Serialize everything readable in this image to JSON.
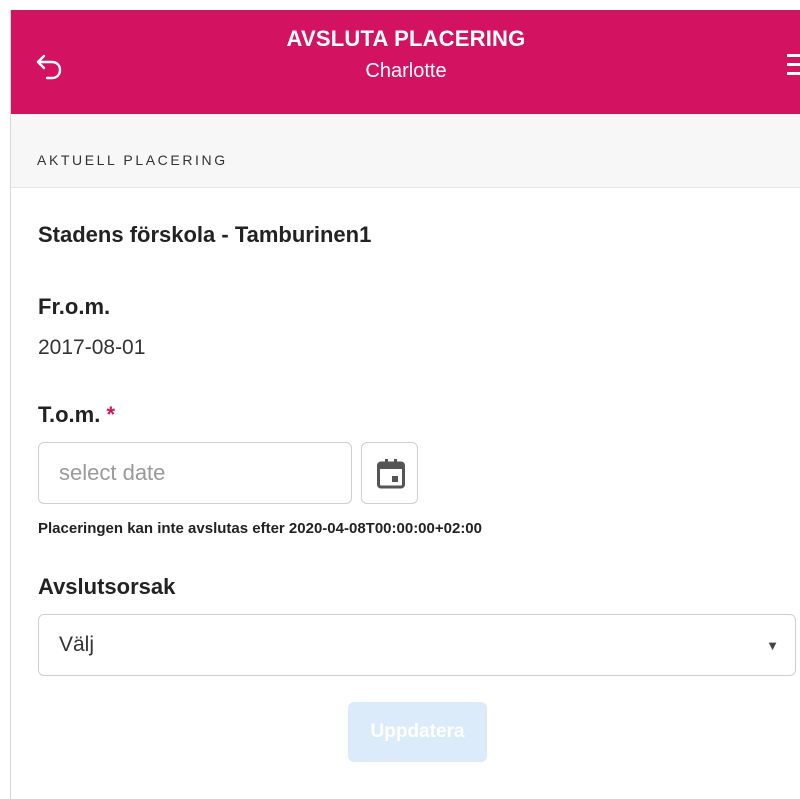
{
  "header": {
    "title": "AVSLUTA PLACERING",
    "subtitle": "Charlotte",
    "back_icon": "back-arrow-icon",
    "menu_icon": "hamburger-menu-icon",
    "color": "#d31261"
  },
  "section": {
    "label": "AKTUELL PLACERING"
  },
  "placement": {
    "unit_name": "Stadens förskola - Tamburinen1",
    "from_label": "Fr.o.m.",
    "from_value": "2017-08-01",
    "to_label": "T.o.m.",
    "to_required_mark": "*",
    "to_placeholder": "select date",
    "to_value": "",
    "calendar_icon": "calendar-icon",
    "hint": "Placeringen kan inte avslutas efter 2020-04-08T00:00:00+02:00"
  },
  "reason": {
    "label": "Avslutsorsak",
    "selected": "Välj"
  },
  "actions": {
    "update_label": "Uppdatera",
    "update_disabled": true
  }
}
